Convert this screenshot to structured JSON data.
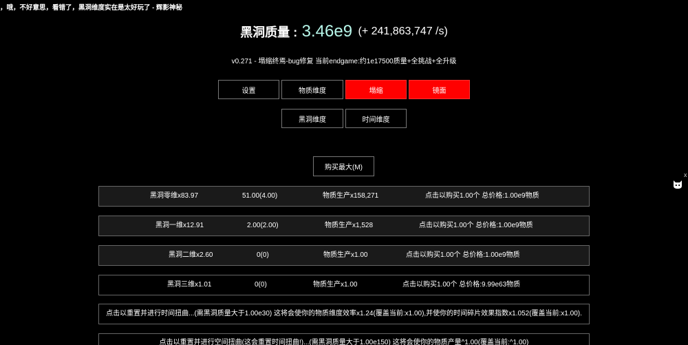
{
  "news": {
    "ticker": "，哦，不好意思，看错了，黑洞维度实在是太好玩了 - 辉影神秘"
  },
  "header": {
    "mass_label": "黑洞质量 :",
    "mass_value": "3.46e9",
    "mass_rate": "(+ 241,863,747 /s)",
    "version": "v0.271 - 塌缩终焉-bug修复 当前endgame:约1e17500质量+全挑战+全升级"
  },
  "tabs": {
    "row1": [
      {
        "label": "设置",
        "active": false
      },
      {
        "label": "物质维度",
        "active": false
      },
      {
        "label": "塌缩",
        "active": true
      },
      {
        "label": "镜面",
        "active": true
      }
    ],
    "row2": [
      {
        "label": "黑洞维度",
        "active": false
      },
      {
        "label": "时间维度",
        "active": false
      }
    ]
  },
  "buy_max": {
    "label": "购买最大(M)"
  },
  "dimensions": [
    {
      "name": "黑洞零维x83.97",
      "amount": "51.00(4.00)",
      "production": "物质生产x158,271",
      "cost": "点击以购买1.00个 总价格:1.00e9物质"
    },
    {
      "name": "黑洞一维x12.91",
      "amount": "2.00(2.00)",
      "production": "物质生产x1,528",
      "cost": "点击以购买1.00个 总价格:1.00e9物质"
    },
    {
      "name": "黑洞二维x2.60",
      "amount": "0(0)",
      "production": "物质生产x1.00",
      "cost": "点击以购买1.00个 总价格:1.00e9物质"
    },
    {
      "name": "黑洞三维x1.01",
      "amount": "0(0)",
      "production": "物质生产x1.00",
      "cost": "点击以购买1.00个 总价格:9.99e63物质"
    }
  ],
  "resets": {
    "time_warp": "点击以重置并进行时间扭曲...(需黑洞质量大于1.00e30) 这将会使你的物质维度效率x1.24(覆盖当前:x1.00),并使你的时间碎片效果指数x1.052(覆盖当前:x1.00).",
    "space_warp": "点击以重置并进行空间扭曲(这会重置时间扭曲!)...(需黑洞质量大于1.00e150) 这将会使你的物质产量^1.00(覆盖当前:^1.00)"
  },
  "side": {
    "icon": "cat-face-icon",
    "close": "x"
  },
  "colors": {
    "active_tab": "#ff0000",
    "mass_value": "#b7f7ea"
  }
}
